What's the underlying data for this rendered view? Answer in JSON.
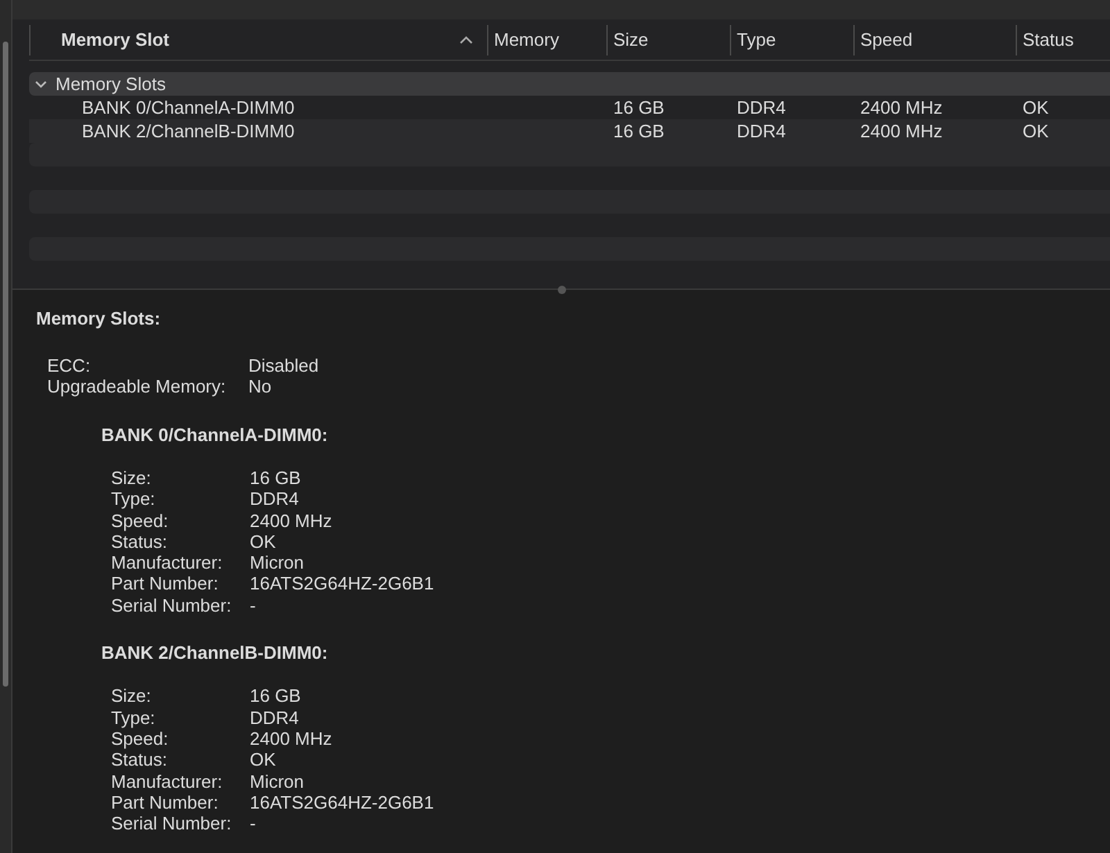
{
  "table": {
    "columns": [
      {
        "label": "Memory Slot",
        "sorted": true
      },
      {
        "label": "Memory",
        "sorted": false
      },
      {
        "label": "Size",
        "sorted": false
      },
      {
        "label": "Type",
        "sorted": false
      },
      {
        "label": "Speed",
        "sorted": false
      },
      {
        "label": "Status",
        "sorted": false
      }
    ],
    "group": {
      "label": "Memory Slots",
      "expanded": true,
      "rows": [
        {
          "cells": [
            "BANK 0/ChannelA-DIMM0",
            "",
            "16 GB",
            "DDR4",
            "2400 MHz",
            "OK"
          ]
        },
        {
          "cells": [
            "BANK 2/ChannelB-DIMM0",
            "",
            "16 GB",
            "DDR4",
            "2400 MHz",
            "OK"
          ]
        }
      ]
    }
  },
  "details": {
    "title": "Memory Slots:",
    "fields": [
      {
        "label": "ECC:",
        "value": "Disabled"
      },
      {
        "label": "Upgradeable Memory:",
        "value": "No"
      }
    ],
    "banks": [
      {
        "title": "BANK 0/ChannelA-DIMM0:",
        "fields": [
          {
            "label": "Size:",
            "value": "16 GB"
          },
          {
            "label": "Type:",
            "value": "DDR4"
          },
          {
            "label": "Speed:",
            "value": "2400 MHz"
          },
          {
            "label": "Status:",
            "value": "OK"
          },
          {
            "label": "Manufacturer:",
            "value": "Micron"
          },
          {
            "label": "Part Number:",
            "value": "16ATS2G64HZ-2G6B1"
          },
          {
            "label": "Serial Number:",
            "value": "-"
          }
        ]
      },
      {
        "title": "BANK 2/ChannelB-DIMM0:",
        "fields": [
          {
            "label": "Size:",
            "value": "16 GB"
          },
          {
            "label": "Type:",
            "value": "DDR4"
          },
          {
            "label": "Speed:",
            "value": "2400 MHz"
          },
          {
            "label": "Status:",
            "value": "OK"
          },
          {
            "label": "Manufacturer:",
            "value": "Micron"
          },
          {
            "label": "Part Number:",
            "value": "16ATS2G64HZ-2G6B1"
          },
          {
            "label": "Serial Number:",
            "value": "-"
          }
        ]
      }
    ]
  }
}
